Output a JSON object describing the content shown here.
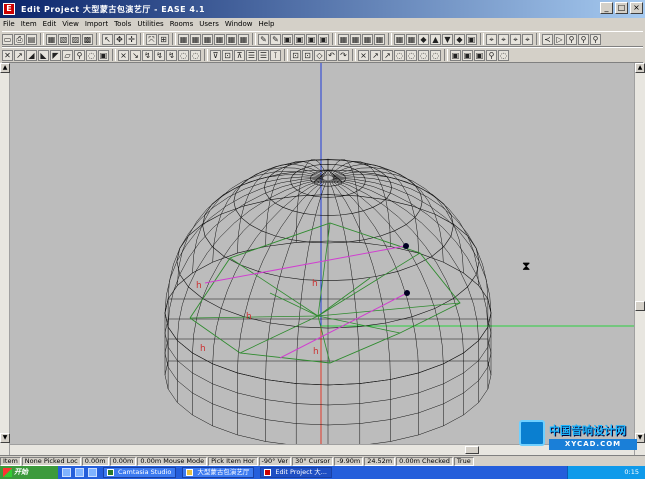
{
  "window": {
    "title": "Edit Project  大型蒙古包演艺厅 - EASE 4.1",
    "buttons": [
      "_",
      "□",
      "×"
    ]
  },
  "menu": [
    "File",
    "Item",
    "Edit",
    "View",
    "Import",
    "Tools",
    "Utilities",
    "Rooms",
    "Users",
    "Window",
    "Help"
  ],
  "toolbar1": [
    "▭",
    "⎙",
    "▤",
    "|",
    "▦",
    "▧",
    "▨",
    "▩",
    "|",
    "↖",
    "✥",
    "✛",
    "|",
    "⤧",
    "⊞",
    "|",
    "▦",
    "▦",
    "▦",
    "▦",
    "▦",
    "▦",
    "|",
    "✎",
    "✎",
    "▣",
    "▣",
    "▣",
    "▣",
    "|",
    "▦",
    "▦",
    "▦",
    "▦",
    "|",
    "▦",
    "▦",
    "◆",
    "▲",
    "▼",
    "◆",
    "▣",
    "|",
    "⌖",
    "⌖",
    "⌖",
    "⌖",
    "|",
    "≺",
    "▷",
    "⚲",
    "⚲",
    "⚲"
  ],
  "toolbar2": [
    "✕",
    "↗",
    "◢",
    "◣",
    "◤",
    "▱",
    "⚲",
    "◌",
    "▣",
    "|",
    "⨯",
    "↘",
    "↯",
    "↯",
    "↯",
    "◌",
    "◌",
    "|",
    "⊽",
    "⊡",
    "⊼",
    "☰",
    "☰",
    "⊺",
    "|",
    "⊡",
    "⊡",
    "◇",
    "↶",
    "↷",
    "|",
    "⨯",
    "↗",
    "↗",
    "◌",
    "◌",
    "◌",
    "◌",
    "|",
    "▣",
    "▣",
    "▣",
    "⚲",
    "◌"
  ],
  "statusbar": [
    "Item",
    "None  Picked Loc",
    "0.00m",
    "0.00m",
    "0.00m  Mouse Mode",
    "Pick Item  Hor",
    "-90°  Ver",
    "30°  Cursor",
    "-9.90m",
    "24.52m",
    "0.00m  Checked",
    "True"
  ],
  "taskbar": {
    "start": "开始",
    "tasks": [
      {
        "label": "Camtasia Studio",
        "active": false
      },
      {
        "label": "大型蒙古包演艺厅",
        "active": false
      },
      {
        "label": "Edit Project  大...",
        "active": true
      }
    ],
    "clock": "0:15"
  },
  "watermark": {
    "title": "中国音响设计网",
    "url": "XYCAD.COM"
  },
  "colors": {
    "viewport_bg": "#bcbcbc",
    "wire": "#111111",
    "axis_x": "#2bcf3f",
    "axis_y": "#1f3bd8",
    "axis_z": "#e03a2a",
    "plan": "#2e8b2e",
    "highlight": "#d040d0",
    "marker": "#cc3333"
  }
}
